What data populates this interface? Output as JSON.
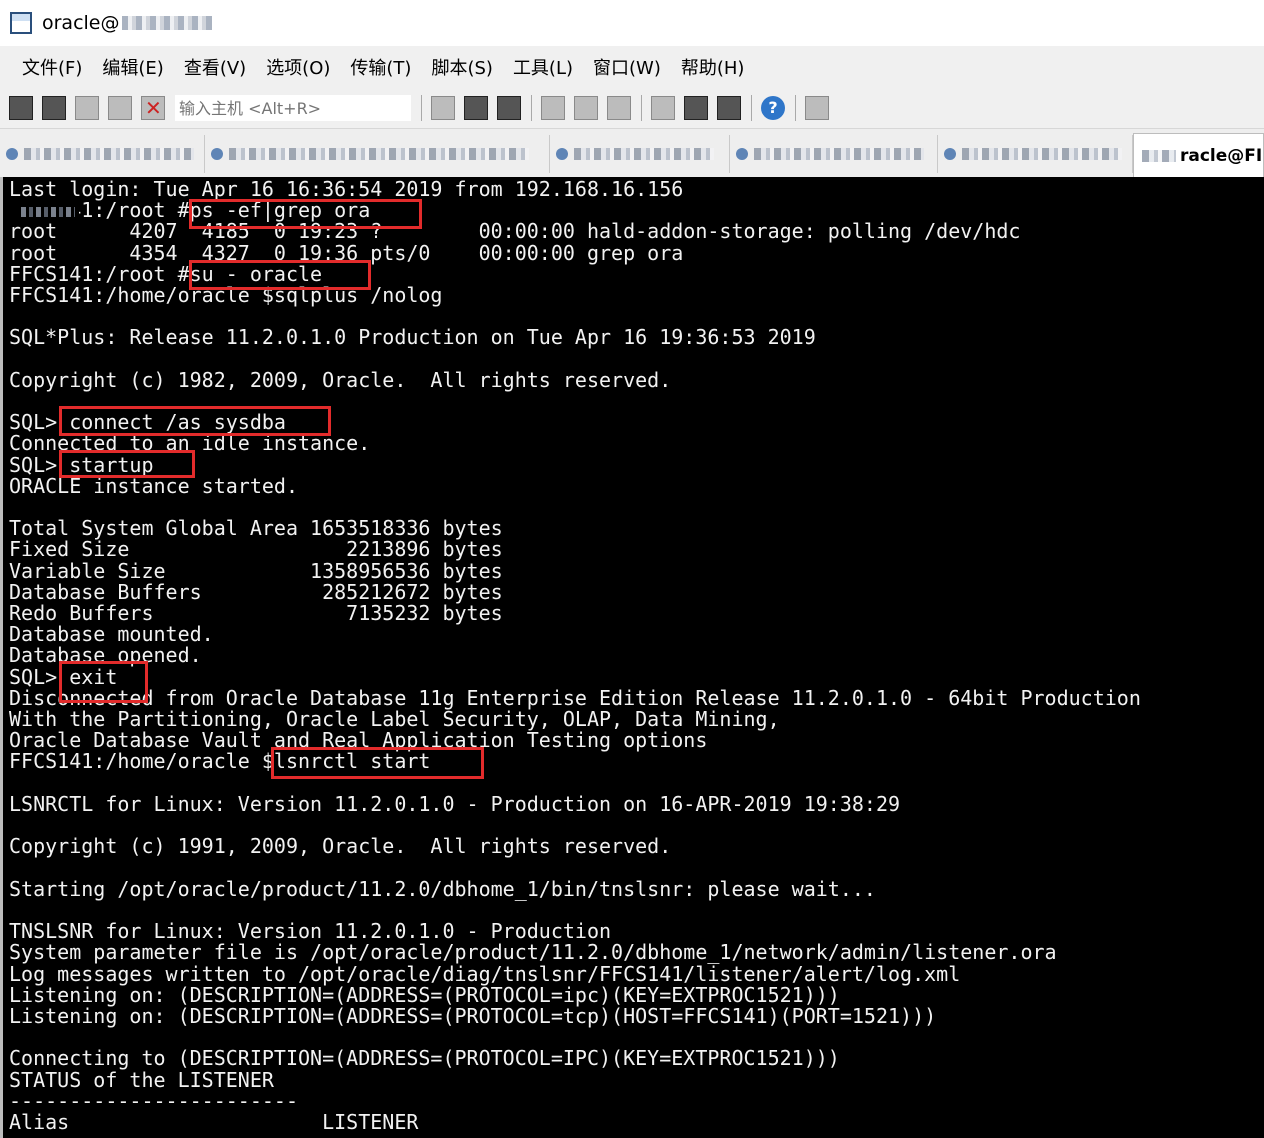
{
  "window": {
    "title": "oracle@"
  },
  "menu": [
    "文件(F)",
    "编辑(E)",
    "查看(V)",
    "选项(O)",
    "传输(T)",
    "脚本(S)",
    "工具(L)",
    "窗口(W)",
    "帮助(H)"
  ],
  "toolbar": {
    "host_placeholder": "输入主机 <Alt+R>",
    "icons": [
      "connect-icon",
      "quick-connect-icon",
      "connect-tab-icon",
      "reconnect-icon",
      "disconnect-icon",
      "copy-icon",
      "paste-icon",
      "find-icon",
      "print-icon",
      "print-screen-icon",
      "print-setup-icon",
      "session-options-icon",
      "global-options-icon",
      "keymap-icon",
      "help-icon",
      "sftp-icon"
    ]
  },
  "tabs": {
    "active_label": "racle@FI"
  },
  "terminal": {
    "lines": [
      "Last login: Tue Apr 16 16:36:54 2019 from 192.168.16.156",
      "    '41:/root #ps -ef|grep ora",
      "root      4207  4185  0 19:23 ?        00:00:00 hald-addon-storage: polling /dev/hdc",
      "root      4354  4327  0 19:36 pts/0    00:00:00 grep ora",
      "FFCS141:/root #su - oracle",
      "FFCS141:/home/oracle $sqlplus /nolog",
      "",
      "SQL*Plus: Release 11.2.0.1.0 Production on Tue Apr 16 19:36:53 2019",
      "",
      "Copyright (c) 1982, 2009, Oracle.  All rights reserved.",
      "",
      "SQL> connect /as sysdba",
      "Connected to an idle instance.",
      "SQL> startup",
      "ORACLE instance started.",
      "",
      "Total System Global Area 1653518336 bytes",
      "Fixed Size                  2213896 bytes",
      "Variable Size            1358956536 bytes",
      "Database Buffers          285212672 bytes",
      "Redo Buffers                7135232 bytes",
      "Database mounted.",
      "Database opened.",
      "SQL> exit",
      "Disconnected from Oracle Database 11g Enterprise Edition Release 11.2.0.1.0 - 64bit Production",
      "With the Partitioning, Oracle Label Security, OLAP, Data Mining,",
      "Oracle Database Vault and Real Application Testing options",
      "FFCS141:/home/oracle $lsnrctl start",
      "",
      "LSNRCTL for Linux: Version 11.2.0.1.0 - Production on 16-APR-2019 19:38:29",
      "",
      "Copyright (c) 1991, 2009, Oracle.  All rights reserved.",
      "",
      "Starting /opt/oracle/product/11.2.0/dbhome_1/bin/tnslsnr: please wait...",
      "",
      "TNSLSNR for Linux: Version 11.2.0.1.0 - Production",
      "System parameter file is /opt/oracle/product/11.2.0/dbhome_1/network/admin/listener.ora",
      "Log messages written to /opt/oracle/diag/tnslsnr/FFCS141/listener/alert/log.xml",
      "Listening on: (DESCRIPTION=(ADDRESS=(PROTOCOL=ipc)(KEY=EXTPROC1521)))",
      "Listening on: (DESCRIPTION=(ADDRESS=(PROTOCOL=tcp)(HOST=FFCS141)(PORT=1521)))",
      "",
      "Connecting to (DESCRIPTION=(ADDRESS=(PROTOCOL=IPC)(KEY=EXTPROC1521)))",
      "STATUS of the LISTENER",
      "------------------------",
      "Alias                     LISTENER"
    ]
  },
  "colors": {
    "terminal_bg": "#000000",
    "terminal_fg": "#f2f2f2",
    "highlight": "#e22b2b"
  }
}
